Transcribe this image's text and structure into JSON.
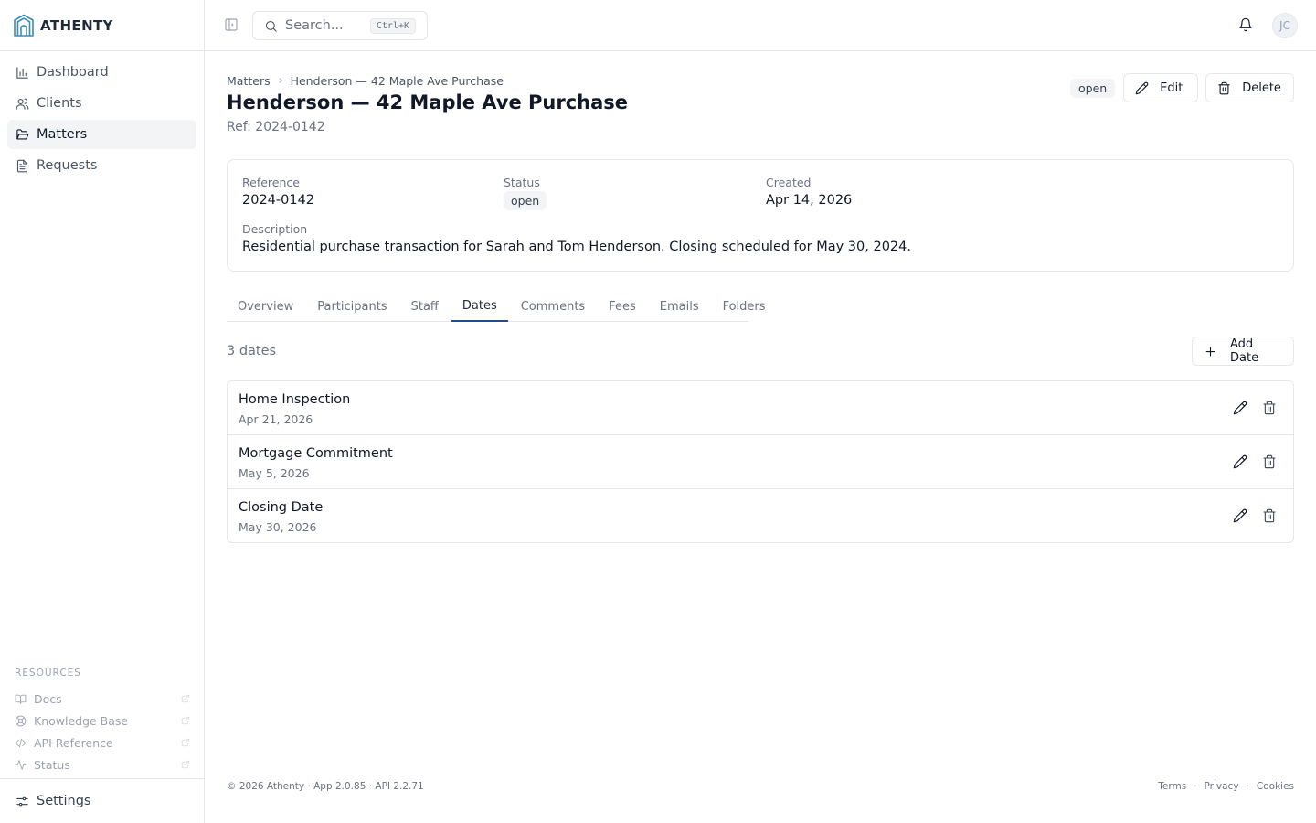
{
  "app": {
    "brand": "ATHENTY"
  },
  "sidebar": {
    "items": [
      {
        "label": "Dashboard",
        "icon": "bar-chart-icon",
        "active": false
      },
      {
        "label": "Clients",
        "icon": "users-icon",
        "active": false
      },
      {
        "label": "Matters",
        "icon": "folder-open-icon",
        "active": true
      },
      {
        "label": "Requests",
        "icon": "file-text-icon",
        "active": false
      }
    ],
    "resources": {
      "heading": "RESOURCES",
      "items": [
        {
          "label": "Docs",
          "icon": "book-open-icon"
        },
        {
          "label": "Knowledge Base",
          "icon": "life-buoy-icon"
        },
        {
          "label": "API Reference",
          "icon": "code-icon"
        },
        {
          "label": "Status",
          "icon": "activity-icon"
        }
      ]
    },
    "settings_label": "Settings"
  },
  "topbar": {
    "search_placeholder": "Search...",
    "search_shortcut": "Ctrl+K",
    "avatar_initials": "JC"
  },
  "breadcrumb": {
    "parent": "Matters",
    "current": "Henderson — 42 Maple Ave Purchase"
  },
  "matter": {
    "title": "Henderson — 42 Maple Ave Purchase",
    "ref_line": "Ref: 2024-0142",
    "status": "open",
    "actions": {
      "edit": "Edit",
      "delete": "Delete"
    },
    "details": {
      "reference_label": "Reference",
      "reference_value": "2024-0142",
      "status_label": "Status",
      "status_value": "open",
      "created_label": "Created",
      "created_value": "Apr 14, 2026",
      "description_label": "Description",
      "description_value": "Residential purchase transaction for Sarah and Tom Henderson. Closing scheduled for May 30, 2024."
    }
  },
  "tabs": [
    "Overview",
    "Participants",
    "Staff",
    "Dates",
    "Comments",
    "Fees",
    "Emails",
    "Folders"
  ],
  "active_tab": "Dates",
  "dates": {
    "count_label": "3 dates",
    "add_label": "Add Date",
    "items": [
      {
        "title": "Home Inspection",
        "date": "Apr 21, 2026"
      },
      {
        "title": "Mortgage Commitment",
        "date": "May 5, 2026"
      },
      {
        "title": "Closing Date",
        "date": "May 30, 2026"
      }
    ]
  },
  "footer": {
    "left": "© 2026 Athenty · App 2.0.85 · API 2.2.71",
    "links": [
      "Terms",
      "Privacy",
      "Cookies"
    ]
  },
  "colors": {
    "accent": "#1e4e8c",
    "logo": "#3b8bb5",
    "border": "#e5e7eb"
  }
}
